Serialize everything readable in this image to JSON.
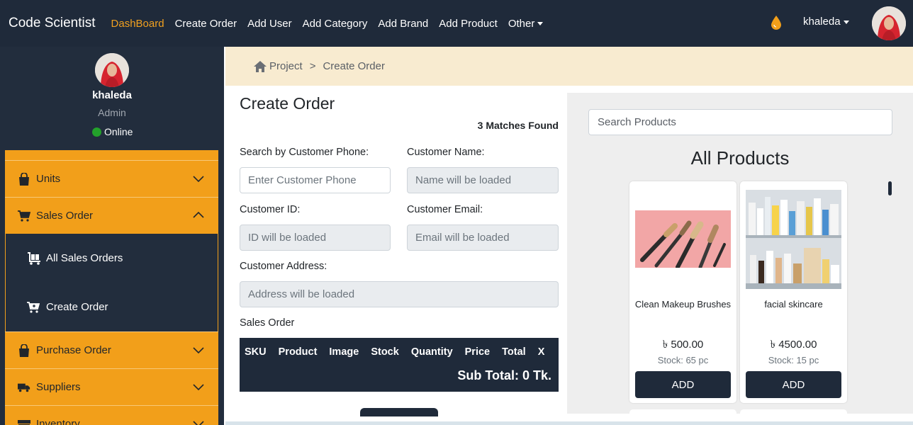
{
  "navbar": {
    "brand": "Code Scientist",
    "links": [
      "DashBoard",
      "Create Order",
      "Add User",
      "Add Category",
      "Add Brand",
      "Add Product",
      "Other"
    ],
    "user": "khaleda"
  },
  "sidebar": {
    "name": "khaleda",
    "role": "Admin",
    "status": "Online",
    "menu": {
      "units": "Units",
      "sales_order": "Sales Order",
      "all_sales_orders": "All Sales Orders",
      "create_order": "Create Order",
      "purchase_order": "Purchase Order",
      "suppliers": "Suppliers",
      "inventory": "Inventory"
    }
  },
  "breadcrumb": {
    "root": "Project",
    "separator": ">",
    "current": "Create Order"
  },
  "form": {
    "title": "Create Order",
    "matches": "3 Matches Found",
    "phone_label": "Search by Customer Phone:",
    "phone_placeholder": "Enter Customer Phone",
    "name_label": "Customer Name:",
    "name_placeholder": "Name will be loaded",
    "id_label": "Customer ID:",
    "id_placeholder": "ID will be loaded",
    "email_label": "Customer Email:",
    "email_placeholder": "Email will be loaded",
    "address_label": "Customer Address:",
    "address_placeholder": "Address will be loaded",
    "sales_order_label": "Sales Order",
    "table_headers": [
      "SKU",
      "Product",
      "Image",
      "Stock",
      "Quantity",
      "Price",
      "Total",
      "X"
    ],
    "subtotal": "Sub Total: 0 Tk."
  },
  "products": {
    "search_placeholder": "Search Products",
    "title": "All Products",
    "items": [
      {
        "name": "Clean Makeup Brushes",
        "price": "৳ 500.00",
        "stock": "Stock: 65 pc",
        "button": "ADD"
      },
      {
        "name": "facial skincare",
        "price": "৳ 4500.00",
        "stock": "Stock: 15 pc",
        "button": "ADD"
      }
    ]
  },
  "colors": {
    "navy": "#1f2a3a",
    "accent": "#f29f1a",
    "active_link": "#f0a020",
    "breadcrumb_bg": "#f8ebd0",
    "online": "#23a12b"
  }
}
